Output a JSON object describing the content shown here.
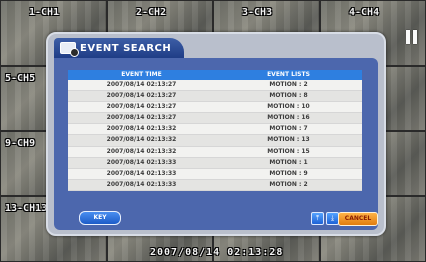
{
  "cameras": [
    "1-CH1",
    "2-CH2",
    "3-CH3",
    "4-CH4",
    "5-CH5",
    "9-CH9",
    "13-CH13"
  ],
  "bottom_timestamp": "2007/08/14 02:13:28",
  "dialog": {
    "title": "EVENT SEARCH",
    "col_time": "EVENT TIME",
    "col_events": "EVENT LISTS",
    "rows": [
      {
        "time": "2007/08/14 02:13:27",
        "event": "MOTION : 2"
      },
      {
        "time": "2007/08/14 02:13:27",
        "event": "MOTION : 8"
      },
      {
        "time": "2007/08/14 02:13:27",
        "event": "MOTION : 10"
      },
      {
        "time": "2007/08/14 02:13:27",
        "event": "MOTION : 16"
      },
      {
        "time": "2007/08/14 02:13:32",
        "event": "MOTION : 7"
      },
      {
        "time": "2007/08/14 02:13:32",
        "event": "MOTION : 13"
      },
      {
        "time": "2007/08/14 02:13:32",
        "event": "MOTION : 15"
      },
      {
        "time": "2007/08/14 02:13:33",
        "event": "MOTION : 1"
      },
      {
        "time": "2007/08/14 02:13:33",
        "event": "MOTION : 9"
      },
      {
        "time": "2007/08/14 02:13:33",
        "event": "MOTION : 2"
      }
    ],
    "key_label": "KEY",
    "cancel_label": "CANCEL",
    "nav_icons": [
      "first-page-icon",
      "last-page-icon",
      "page-up-icon",
      "page-down-icon"
    ]
  }
}
